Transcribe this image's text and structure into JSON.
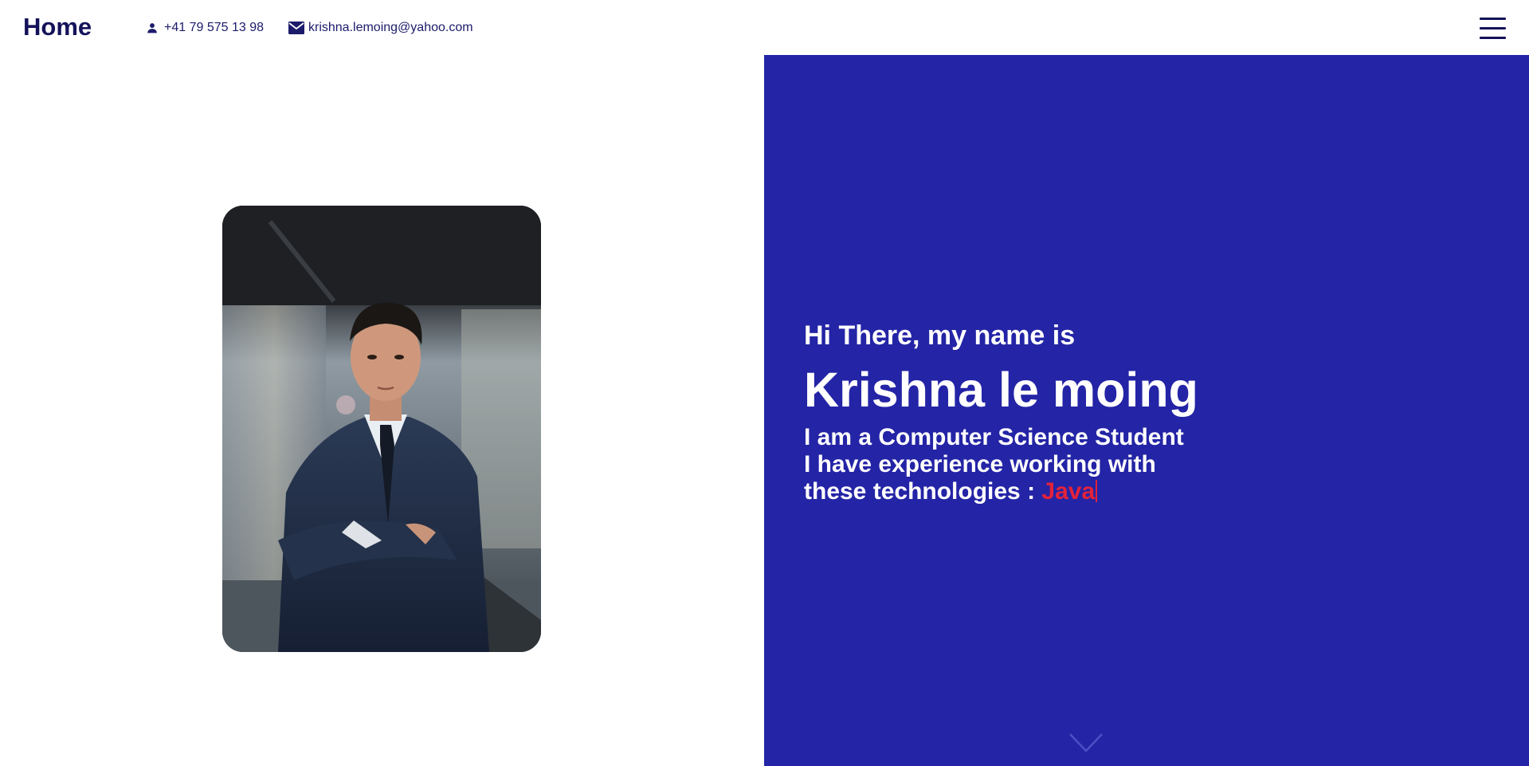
{
  "header": {
    "home_label": "Home",
    "phone": "+41 79 575 13 98",
    "email": "krishna.lemoing@yahoo.com",
    "phone_icon": "person-icon",
    "email_icon": "envelope-icon",
    "menu_icon": "hamburger-menu-icon"
  },
  "hero": {
    "greeting": "Hi There, my name is",
    "name": "Krishna le moing",
    "bio_line1": "I am a Computer Science Student",
    "bio_line2": "I have experience working with",
    "bio_line3": "these technologies : ",
    "typed_tech": "Java",
    "scroll_icon": "chevron-down-icon"
  },
  "colors": {
    "accent_blue": "#2424a6",
    "text_navy": "#14125a",
    "typed_red": "#e3223b"
  }
}
